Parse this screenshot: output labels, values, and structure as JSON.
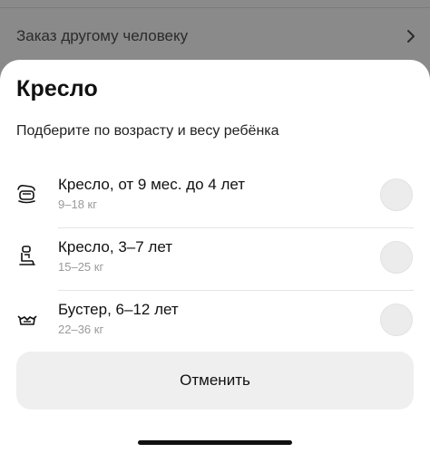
{
  "background": {
    "row_label": "Заказ другому человеку",
    "row_icon": "chevron-right-icon"
  },
  "sheet": {
    "title": "Кресло",
    "subtitle": "Подберите по возрасту и весу ребёнка",
    "options": [
      {
        "label": "Кресло, от 9 мес. до 4 лет",
        "weight": "9–18 кг",
        "icon": "infant-car-seat-icon",
        "selected": false
      },
      {
        "label": "Кресло, 3–7 лет",
        "weight": "15–25 кг",
        "icon": "child-car-seat-icon",
        "selected": false
      },
      {
        "label": "Бустер, 6–12 лет",
        "weight": "22–36 кг",
        "icon": "booster-seat-icon",
        "selected": false
      }
    ],
    "cancel_label": "Отменить"
  },
  "colors": {
    "backdrop": "#8a8a8a",
    "radio": "#ececec",
    "button": "#efefef",
    "secondary_text": "#9a9a9a"
  }
}
